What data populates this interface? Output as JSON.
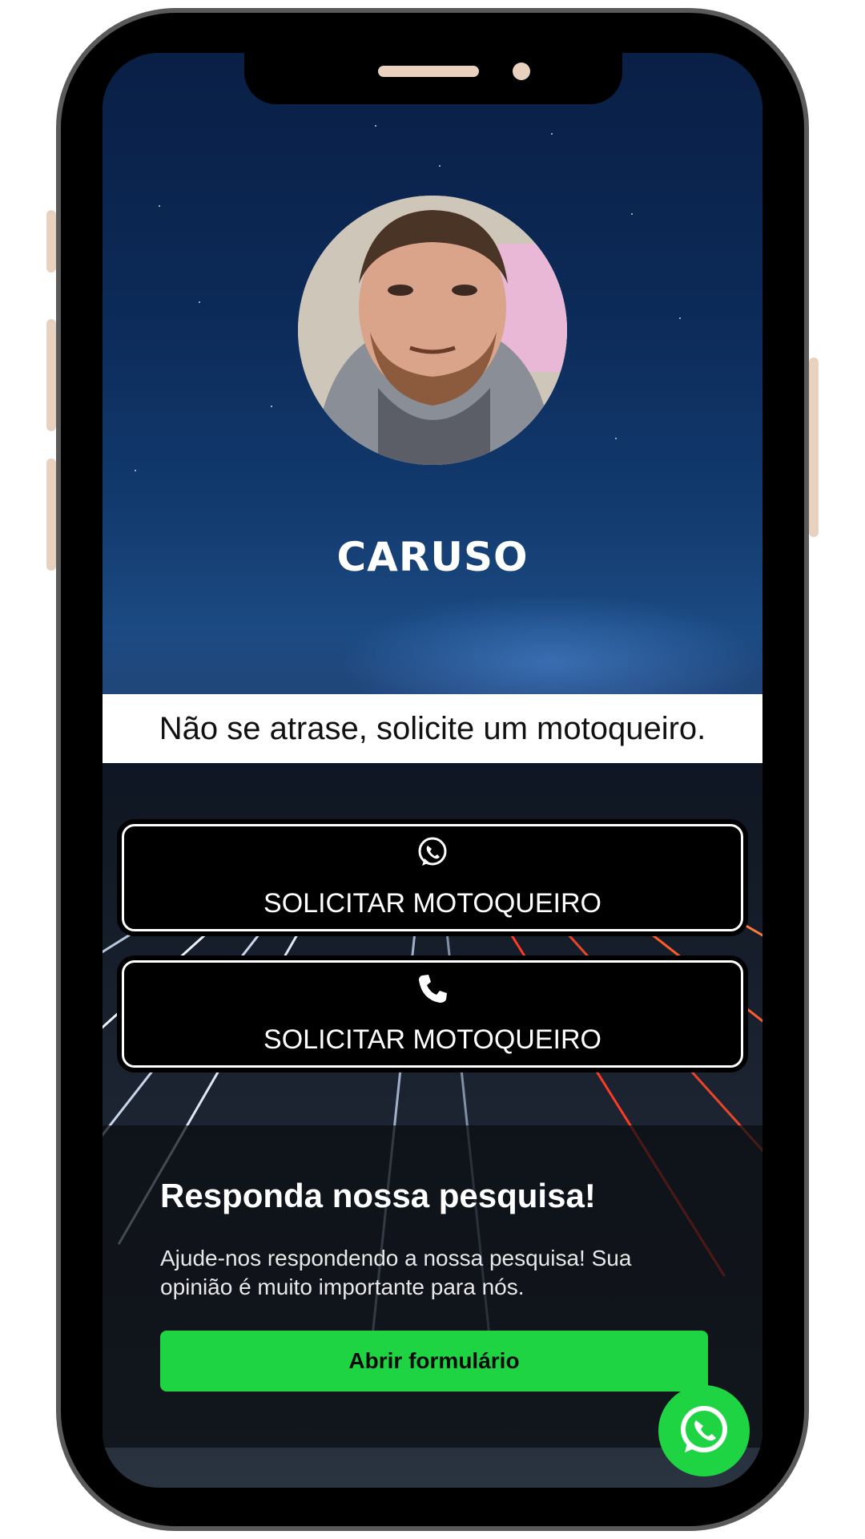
{
  "profile": {
    "name": "CARUSO",
    "avatar_alt": "profile photo"
  },
  "tagline": "Não se atrase, solicite um motoqueiro.",
  "buttons": [
    {
      "icon": "whatsapp-icon",
      "label": "SOLICITAR MOTOQUEIRO"
    },
    {
      "icon": "phone-icon",
      "label": "SOLICITAR MOTOQUEIRO"
    }
  ],
  "survey": {
    "title": "Responda nossa pesquisa!",
    "text": "Ajude-nos respondendo a nossa pesquisa! Sua opinião é muito importante para nós.",
    "cta": "Abrir formulário"
  },
  "floating": {
    "icon": "whatsapp-icon"
  },
  "colors": {
    "accent_green": "#1fd443",
    "button_bg": "#000000",
    "frame_accent": "#e8d2bf"
  }
}
